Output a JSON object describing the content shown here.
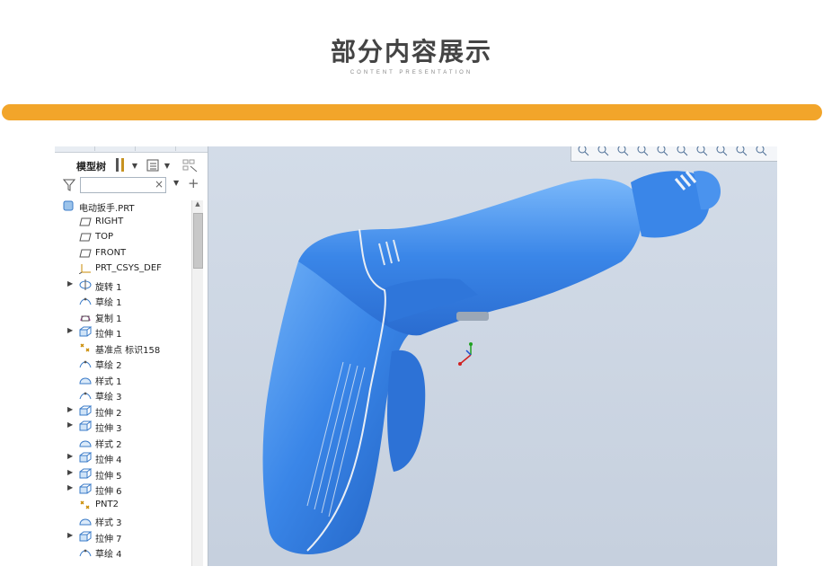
{
  "header": {
    "title": "部分内容展示",
    "subtitle": "CONTENT PRESENTATION"
  },
  "colors": {
    "accent_bar": "#f2a52a",
    "model_blue": "#3a86e8",
    "viewport_bg": "#ccd6e3"
  },
  "model_tree": {
    "toolbar_label": "模型树",
    "filter_placeholder": "",
    "root": {
      "label": "电动扳手.PRT",
      "icon": "part-icon"
    },
    "items": [
      {
        "label": "RIGHT",
        "icon": "datum-plane-icon",
        "expandable": false
      },
      {
        "label": "TOP",
        "icon": "datum-plane-icon",
        "expandable": false
      },
      {
        "label": "FRONT",
        "icon": "datum-plane-icon",
        "expandable": false
      },
      {
        "label": "PRT_CSYS_DEF",
        "icon": "csys-icon",
        "expandable": false
      },
      {
        "label": "旋转 1",
        "icon": "revolve-icon",
        "expandable": true
      },
      {
        "label": "草绘 1",
        "icon": "sketch-icon",
        "expandable": false
      },
      {
        "label": "复制 1",
        "icon": "copy-icon",
        "expandable": false
      },
      {
        "label": "拉伸 1",
        "icon": "extrude-icon",
        "expandable": true
      },
      {
        "label": "基准点 标识158",
        "icon": "datum-point-icon",
        "expandable": false
      },
      {
        "label": "草绘 2",
        "icon": "sketch-icon",
        "expandable": false
      },
      {
        "label": "样式 1",
        "icon": "style-icon",
        "expandable": false
      },
      {
        "label": "草绘 3",
        "icon": "sketch-icon",
        "expandable": false
      },
      {
        "label": "拉伸 2",
        "icon": "extrude-icon",
        "expandable": true
      },
      {
        "label": "拉伸 3",
        "icon": "extrude-icon",
        "expandable": true
      },
      {
        "label": "样式 2",
        "icon": "style-icon",
        "expandable": false
      },
      {
        "label": "拉伸 4",
        "icon": "extrude-icon",
        "expandable": true
      },
      {
        "label": "拉伸 5",
        "icon": "extrude-icon",
        "expandable": true
      },
      {
        "label": "拉伸 6",
        "icon": "extrude-icon",
        "expandable": true
      },
      {
        "label": "PNT2",
        "icon": "datum-point-icon",
        "expandable": false
      },
      {
        "label": "样式 3",
        "icon": "style-icon",
        "expandable": false
      },
      {
        "label": "拉伸 7",
        "icon": "extrude-icon",
        "expandable": true
      },
      {
        "label": "草绘 4",
        "icon": "sketch-icon",
        "expandable": false
      }
    ]
  },
  "view_toolbar": {
    "buttons": [
      "zoom-fit-icon",
      "zoom-in-icon",
      "zoom-out-icon",
      "repaint-icon",
      "display-style-icon",
      "saved-views-icon",
      "view-manager-icon",
      "perspective-icon",
      "datum-display-icon",
      "annotation-display-icon"
    ]
  }
}
